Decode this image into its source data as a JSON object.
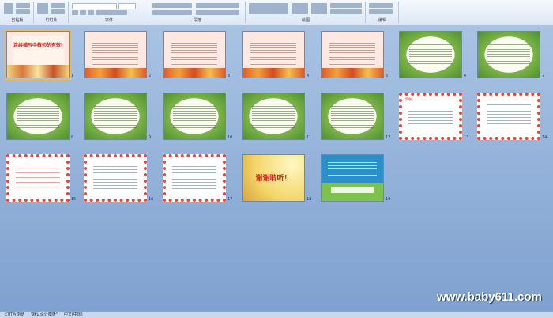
{
  "ribbon": {
    "groups": [
      {
        "name": "clipboard",
        "label": "剪贴板"
      },
      {
        "name": "slides",
        "label": "幻灯片"
      },
      {
        "name": "font",
        "label": "字体"
      },
      {
        "name": "paragraph",
        "label": "段落"
      },
      {
        "name": "drawing",
        "label": "绘图"
      },
      {
        "name": "editing",
        "label": "编辑"
      }
    ]
  },
  "slides": [
    {
      "n": "1",
      "title": "连续描写中教师的有效指导"
    },
    {
      "n": "2",
      "title": ""
    },
    {
      "n": "3",
      "title": ""
    },
    {
      "n": "4",
      "title": ""
    },
    {
      "n": "5",
      "title": ""
    },
    {
      "n": "6",
      "title": ""
    },
    {
      "n": "7",
      "title": ""
    },
    {
      "n": "8",
      "title": ""
    },
    {
      "n": "9",
      "title": ""
    },
    {
      "n": "10",
      "title": ""
    },
    {
      "n": "11",
      "title": ""
    },
    {
      "n": "12",
      "title": ""
    },
    {
      "n": "13",
      "title": ""
    },
    {
      "n": "14",
      "title": ""
    },
    {
      "n": "15",
      "title": ""
    },
    {
      "n": "16",
      "title": ""
    },
    {
      "n": "17",
      "title": ""
    },
    {
      "n": "18",
      "title": "谢谢聆听！"
    },
    {
      "n": "19",
      "title": ""
    }
  ],
  "slide13_title": "案例：",
  "status": {
    "view": "幻灯片浏览",
    "theme": "\"默认设计模板\"",
    "language": "中文(中国)"
  },
  "watermark": "www.baby611.com"
}
